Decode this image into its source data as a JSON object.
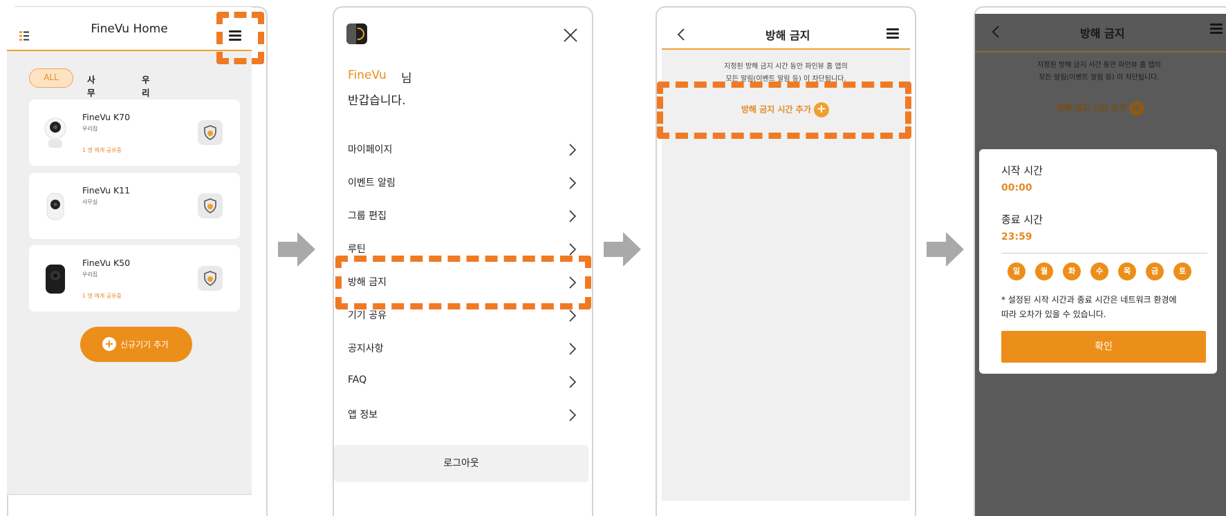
{
  "screen1": {
    "title": "FineVu Home",
    "tabs": [
      "ALL",
      "사무실",
      "우리집"
    ],
    "devices": [
      {
        "name": "FineVu K70",
        "group": "우리집",
        "shared": "1 명 에게 공유중"
      },
      {
        "name": "FineVu K11",
        "group": "사무실",
        "shared": ""
      },
      {
        "name": "FineVu K50",
        "group": "우리집",
        "shared": "1 명 에게 공유중"
      }
    ],
    "add_device_label": "신규기기 추가"
  },
  "screen2": {
    "greeting_brand": "FineVu",
    "greeting_suffix": "님",
    "greeting_line2": "반갑습니다.",
    "menu": [
      "마이페이지",
      "이벤트 알림",
      "그룹 편집",
      "루틴",
      "방해 금지",
      "기기 공유",
      "공지사항",
      "FAQ",
      "앱 정보"
    ],
    "logout_label": "로그아웃"
  },
  "screen3": {
    "title": "방해 금지",
    "desc_line1": "지정된 방해 금지 시간 동안 파인뷰 홈 앱의",
    "desc_line2": "모든 알림(이벤트 알림 등) 이 차단됩니다.",
    "add_time_label": "방해 금지 시간 추가"
  },
  "screen4": {
    "title": "방해 금지",
    "desc_line1": "지정된 방해 금지 시간 동안 파인뷰 홈 앱의",
    "desc_line2": "모든 알림(이벤트 알림 등) 이 차단됩니다.",
    "add_time_label": "방해 금지 시간 추가",
    "dialog": {
      "start_label": "시작 시간",
      "start_value": "00:00",
      "end_label": "종료 시간",
      "end_value": "23:59",
      "days": [
        "일",
        "월",
        "화",
        "수",
        "목",
        "금",
        "토"
      ],
      "note_line1": "* 설정된 시작 시간과 종료 시간은 네트워크 환경에",
      "note_line2": "따라 오차가 있을 수 있습니다.",
      "confirm_label": "확인"
    }
  },
  "colors": {
    "accent": "#ec8f1a",
    "highlight": "#f07a23",
    "frame": "#d4d4d4"
  }
}
